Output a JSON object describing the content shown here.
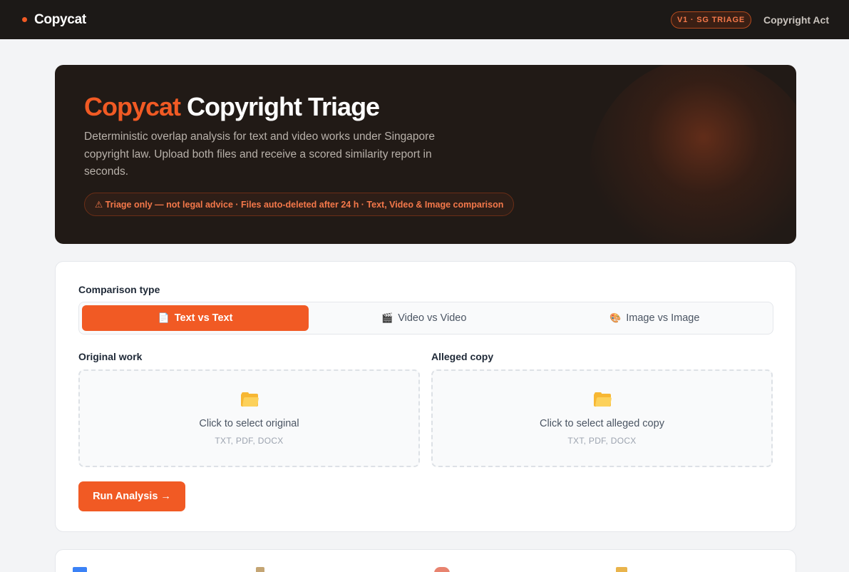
{
  "nav": {
    "brand": "Copycat",
    "badge": "V1 · SG TRIAGE",
    "link": "Copyright Act"
  },
  "hero": {
    "title_accent": "Copycat",
    "title_rest": "Copyright Triage",
    "description": "Deterministic overlap analysis for text and video works under Singapore copyright law. Upload both files and receive a scored similarity report in seconds.",
    "notice": "⚠ Triage only — not legal advice · Files auto-deleted after 24 h · Text, Video & Image comparison"
  },
  "form": {
    "comparison_label": "Comparison type",
    "tabs": [
      {
        "label": "Text vs Text",
        "icon": "document-icon",
        "glyph": "📄",
        "active": true
      },
      {
        "label": "Video vs Video",
        "icon": "clapperboard-icon",
        "glyph": "🎬",
        "active": false
      },
      {
        "label": "Image vs Image",
        "icon": "palette-icon",
        "glyph": "🎨",
        "active": false
      }
    ],
    "original": {
      "label": "Original work",
      "prompt": "Click to select original",
      "formats": "TXT, PDF, DOCX"
    },
    "alleged": {
      "label": "Alleged copy",
      "prompt": "Click to select alleged copy",
      "formats": "TXT, PDF, DOCX"
    },
    "run_button": "Run Analysis →"
  },
  "colors": {
    "accent": "#f15a24",
    "nav_bg": "#1c1917",
    "hero_bg": "#211a16"
  },
  "bottom_icons": [
    "numbers-icon",
    "dagger-icon",
    "palette-icon",
    "bag-icon"
  ]
}
